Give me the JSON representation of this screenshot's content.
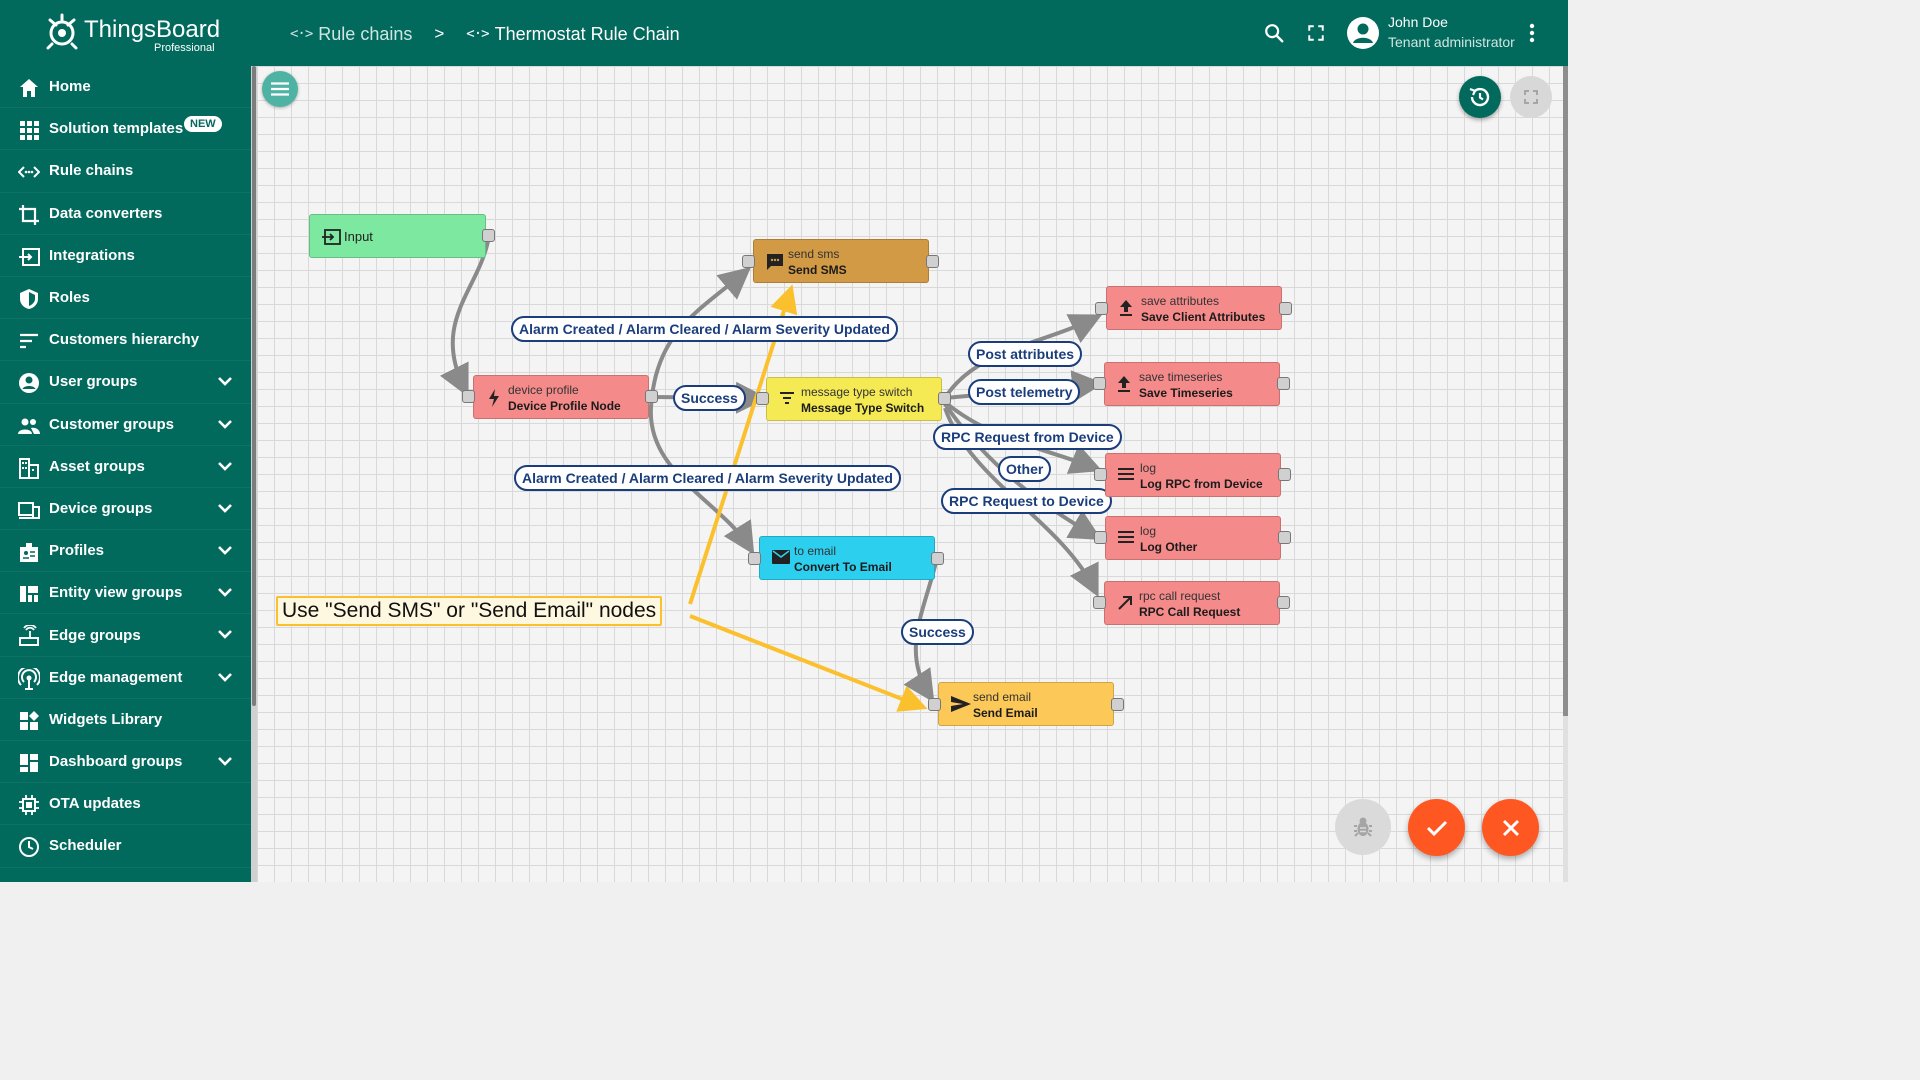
{
  "app": {
    "logo_title": "ThingsBoard",
    "logo_sub": "Professional"
  },
  "breadcrumb": {
    "rule_chains": "Rule chains",
    "separator": ">",
    "current": "Thermostat Rule Chain"
  },
  "user": {
    "name": "John Doe",
    "role": "Tenant administrator"
  },
  "sidebar": {
    "new_badge": "NEW",
    "items": [
      {
        "label": "Home",
        "icon": "home-icon",
        "expandable": false
      },
      {
        "label": "Solution templates",
        "icon": "grid-icon",
        "expandable": false
      },
      {
        "label": "Rule chains",
        "icon": "code-arrows-icon",
        "expandable": false
      },
      {
        "label": "Data converters",
        "icon": "crop-icon",
        "expandable": false
      },
      {
        "label": "Integrations",
        "icon": "input-icon",
        "expandable": false
      },
      {
        "label": "Roles",
        "icon": "shield-icon",
        "expandable": false
      },
      {
        "label": "Customers hierarchy",
        "icon": "sort-icon",
        "expandable": false
      },
      {
        "label": "User groups",
        "icon": "account-circle-icon",
        "expandable": true
      },
      {
        "label": "Customer groups",
        "icon": "people-icon",
        "expandable": true
      },
      {
        "label": "Asset groups",
        "icon": "domain-icon",
        "expandable": true
      },
      {
        "label": "Device groups",
        "icon": "devices-icon",
        "expandable": true
      },
      {
        "label": "Profiles",
        "icon": "badge-icon",
        "expandable": true
      },
      {
        "label": "Entity view groups",
        "icon": "view-quilt-icon",
        "expandable": true
      },
      {
        "label": "Edge groups",
        "icon": "router-icon",
        "expandable": true
      },
      {
        "label": "Edge management",
        "icon": "settings-input-antenna-icon",
        "expandable": true
      },
      {
        "label": "Widgets Library",
        "icon": "widgets-icon",
        "expandable": false
      },
      {
        "label": "Dashboard groups",
        "icon": "dashboard-icon",
        "expandable": true
      },
      {
        "label": "OTA updates",
        "icon": "memory-icon",
        "expandable": false
      },
      {
        "label": "Scheduler",
        "icon": "schedule-icon",
        "expandable": false
      }
    ]
  },
  "nodes": {
    "input": {
      "name": "Input",
      "color": "#7de8a0"
    },
    "device_profile": {
      "type": "device profile",
      "name": "Device Profile Node",
      "color": "#f48a8a"
    },
    "send_sms": {
      "type": "send sms",
      "name": "Send SMS",
      "color": "#d29a45"
    },
    "msg_switch": {
      "type": "message type switch",
      "name": "Message Type Switch",
      "color": "#f5ea53"
    },
    "to_email": {
      "type": "to email",
      "name": "Convert To Email",
      "color": "#2dcfef"
    },
    "send_email": {
      "type": "send email",
      "name": "Send Email",
      "color": "#fcc858"
    },
    "save_attributes": {
      "type": "save attributes",
      "name": "Save Client Attributes",
      "color": "#f48a8a"
    },
    "save_timeseries": {
      "type": "save timeseries",
      "name": "Save Timeseries",
      "color": "#f48a8a"
    },
    "log_rpc": {
      "type": "log",
      "name": "Log RPC from Device",
      "color": "#f48a8a"
    },
    "log_other": {
      "type": "log",
      "name": "Log Other",
      "color": "#f48a8a"
    },
    "rpc_call": {
      "type": "rpc call request",
      "name": "RPC Call Request",
      "color": "#f48a8a"
    }
  },
  "edge_labels": {
    "alarm_top": "Alarm Created / Alarm Cleared / Alarm Severity Updated",
    "alarm_bottom": "Alarm Created / Alarm Cleared / Alarm Severity Updated",
    "success_profile": "Success",
    "post_attributes": "Post attributes",
    "post_telemetry": "Post telemetry",
    "rpc_from_device": "RPC Request from Device",
    "other": "Other",
    "rpc_to_device": "RPC Request to Device",
    "success_email": "Success"
  },
  "callout": {
    "text": "Use \"Send SMS\" or \"Send Email\" nodes",
    "color": "#fbc02d"
  },
  "colors": {
    "primary": "#02695d",
    "accent": "#ff5722",
    "edge_label": "#1a3d7c"
  }
}
